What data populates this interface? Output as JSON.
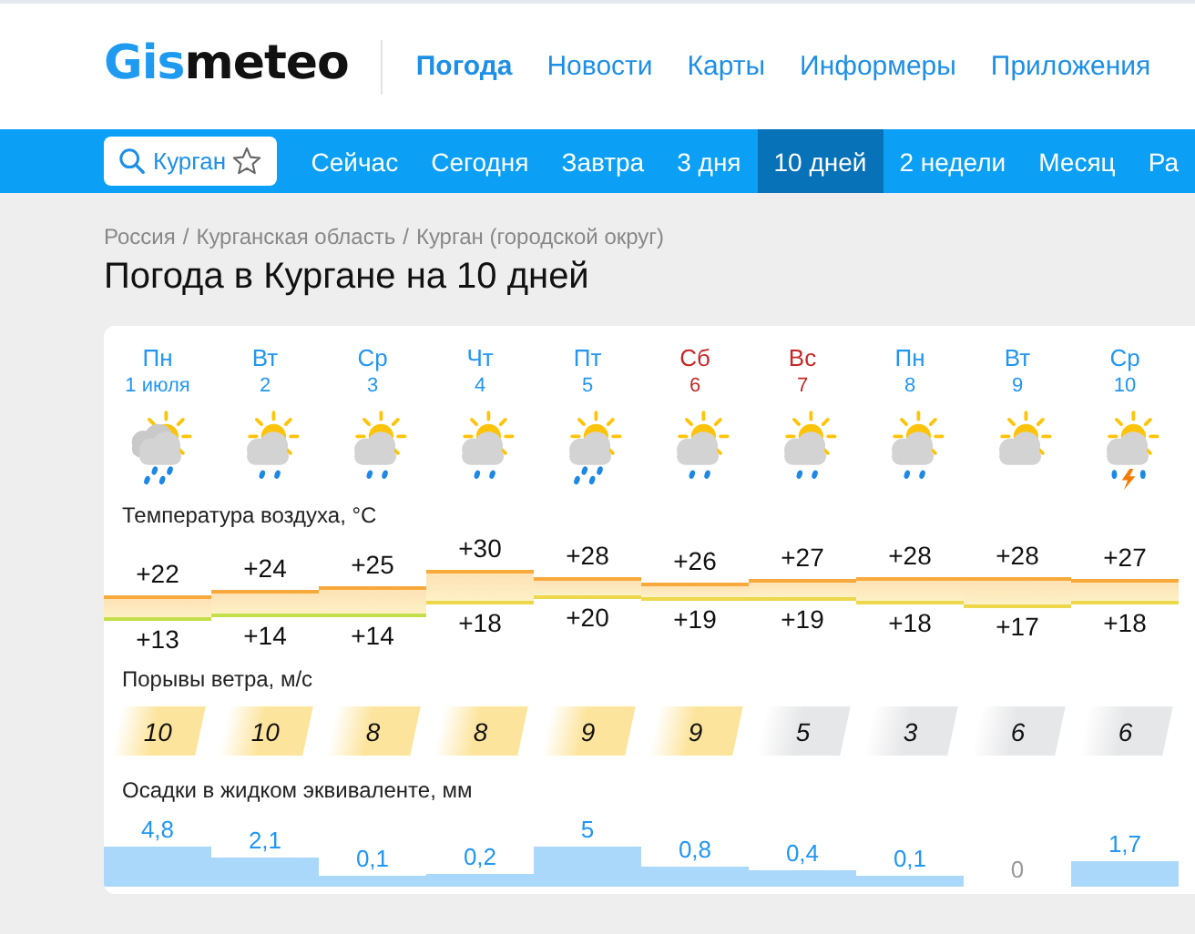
{
  "logo": {
    "accent": "Gis",
    "rest": "meteo"
  },
  "nav": [
    {
      "label": "Погода",
      "selected": true
    },
    {
      "label": "Новости",
      "selected": false
    },
    {
      "label": "Карты",
      "selected": false
    },
    {
      "label": "Информеры",
      "selected": false
    },
    {
      "label": "Приложения",
      "selected": false
    }
  ],
  "search": {
    "value": "Курган"
  },
  "tabs": [
    {
      "label": "Сейчас",
      "selected": false
    },
    {
      "label": "Сегодня",
      "selected": false
    },
    {
      "label": "Завтра",
      "selected": false
    },
    {
      "label": "3 дня",
      "selected": false
    },
    {
      "label": "10 дней",
      "selected": true
    },
    {
      "label": "2 недели",
      "selected": false
    },
    {
      "label": "Месяц",
      "selected": false
    },
    {
      "label": "Ра",
      "selected": false
    }
  ],
  "breadcrumbs": [
    "Россия",
    "Курганская область",
    "Курган (городской округ)"
  ],
  "separator": "/",
  "title": "Погода в Кургане на 10 дней",
  "temperature_label": "Температура воздуха, °C",
  "wind_label": "Порывы ветра, м/с",
  "precip_label": "Осадки в жидком эквиваленте, мм",
  "days": [
    {
      "weekday": "Пн",
      "date": "1 июля",
      "weekend": false,
      "kind": "heavy_rain_clouds",
      "max": "+22",
      "min": "+13",
      "gust": "10",
      "color": "#fde49c",
      "precip": "4,8"
    },
    {
      "weekday": "Вт",
      "date": "2",
      "weekend": false,
      "kind": "rain",
      "max": "+24",
      "min": "+14",
      "gust": "10",
      "color": "#fde49c",
      "precip": "2,1"
    },
    {
      "weekday": "Ср",
      "date": "3",
      "weekend": false,
      "kind": "rain",
      "max": "+25",
      "min": "+14",
      "gust": "8",
      "color": "#fde49c",
      "precip": "0,1"
    },
    {
      "weekday": "Чт",
      "date": "4",
      "weekend": false,
      "kind": "rain",
      "max": "+30",
      "min": "+18",
      "gust": "8",
      "color": "#fde49c",
      "precip": "0,2"
    },
    {
      "weekday": "Пт",
      "date": "5",
      "weekend": false,
      "kind": "heavy_rain",
      "max": "+28",
      "min": "+20",
      "gust": "9",
      "color": "#fde49c",
      "precip": "5"
    },
    {
      "weekday": "Сб",
      "date": "6",
      "weekend": true,
      "kind": "rain",
      "max": "+26",
      "min": "+19",
      "gust": "9",
      "color": "#fde49c",
      "precip": "0,8"
    },
    {
      "weekday": "Вс",
      "date": "7",
      "weekend": true,
      "kind": "rain",
      "max": "+27",
      "min": "+19",
      "gust": "5",
      "color": "#e6e7e8",
      "precip": "0,4"
    },
    {
      "weekday": "Пн",
      "date": "8",
      "weekend": false,
      "kind": "rain",
      "max": "+28",
      "min": "+18",
      "gust": "3",
      "color": "#e6e7e8",
      "precip": "0,1"
    },
    {
      "weekday": "Вт",
      "date": "9",
      "weekend": false,
      "kind": "cloudy",
      "max": "+28",
      "min": "+17",
      "gust": "6",
      "color": "#e6e7e8",
      "precip": "0"
    },
    {
      "weekday": "Ср",
      "date": "10",
      "weekend": false,
      "kind": "storm",
      "max": "+27",
      "min": "+18",
      "gust": "6",
      "color": "#e6e7e8",
      "precip": "1,7"
    }
  ]
}
